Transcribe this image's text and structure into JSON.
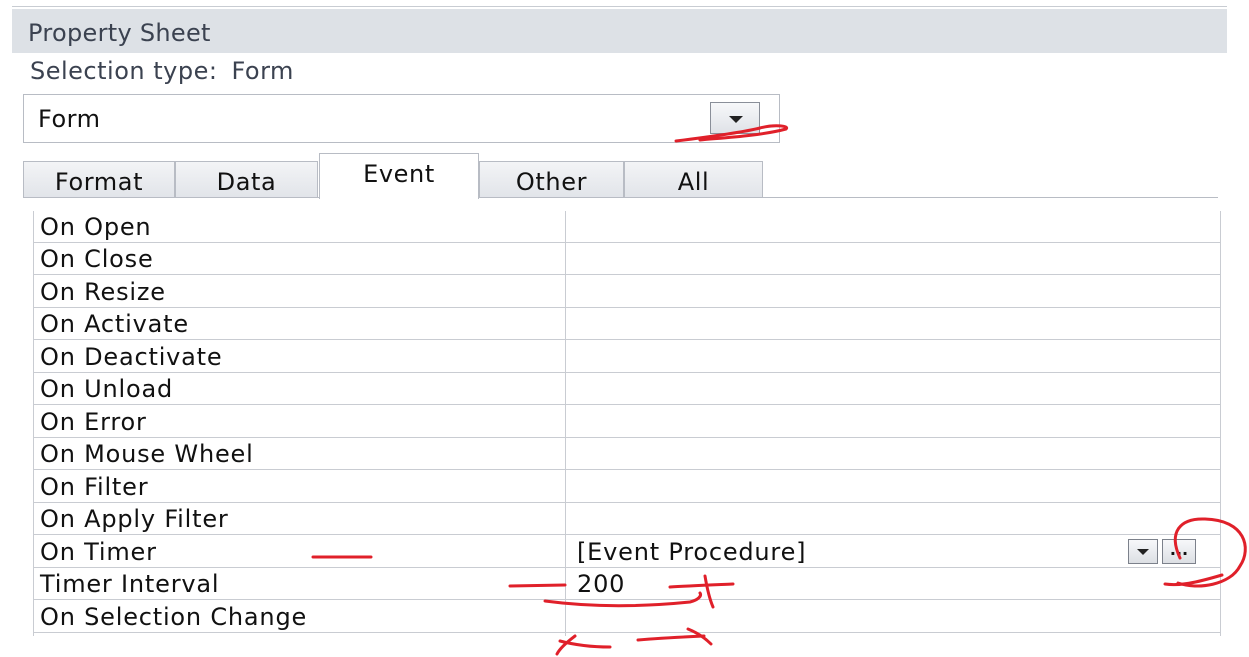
{
  "panel": {
    "title": "Property Sheet",
    "selection_type_label": "Selection type:",
    "selection_type_value": "Form"
  },
  "object_selector": {
    "value": "Form",
    "icon": "chevron-down-icon"
  },
  "tabs": [
    {
      "label": "Format",
      "active": false
    },
    {
      "label": "Data",
      "active": false
    },
    {
      "label": "Event",
      "active": true
    },
    {
      "label": "Other",
      "active": false
    },
    {
      "label": "All",
      "active": false
    }
  ],
  "properties": [
    {
      "name": "On Open",
      "value": ""
    },
    {
      "name": "On Close",
      "value": ""
    },
    {
      "name": "On Resize",
      "value": ""
    },
    {
      "name": "On Activate",
      "value": ""
    },
    {
      "name": "On Deactivate",
      "value": ""
    },
    {
      "name": "On Unload",
      "value": ""
    },
    {
      "name": "On Error",
      "value": ""
    },
    {
      "name": "On Mouse Wheel",
      "value": ""
    },
    {
      "name": "On Filter",
      "value": ""
    },
    {
      "name": "On Apply Filter",
      "value": ""
    },
    {
      "name": "On Timer",
      "value": "[Event Procedure]"
    },
    {
      "name": "Timer Interval",
      "value": "200"
    },
    {
      "name": "On Selection Change",
      "value": ""
    }
  ],
  "on_timer_controls": {
    "dropdown_icon": "chevron-down-icon",
    "build_label": "..."
  },
  "colors": {
    "annotation": "#e0202a",
    "title_bar": "#dde1e6",
    "grid_line": "#c9ccd2"
  }
}
